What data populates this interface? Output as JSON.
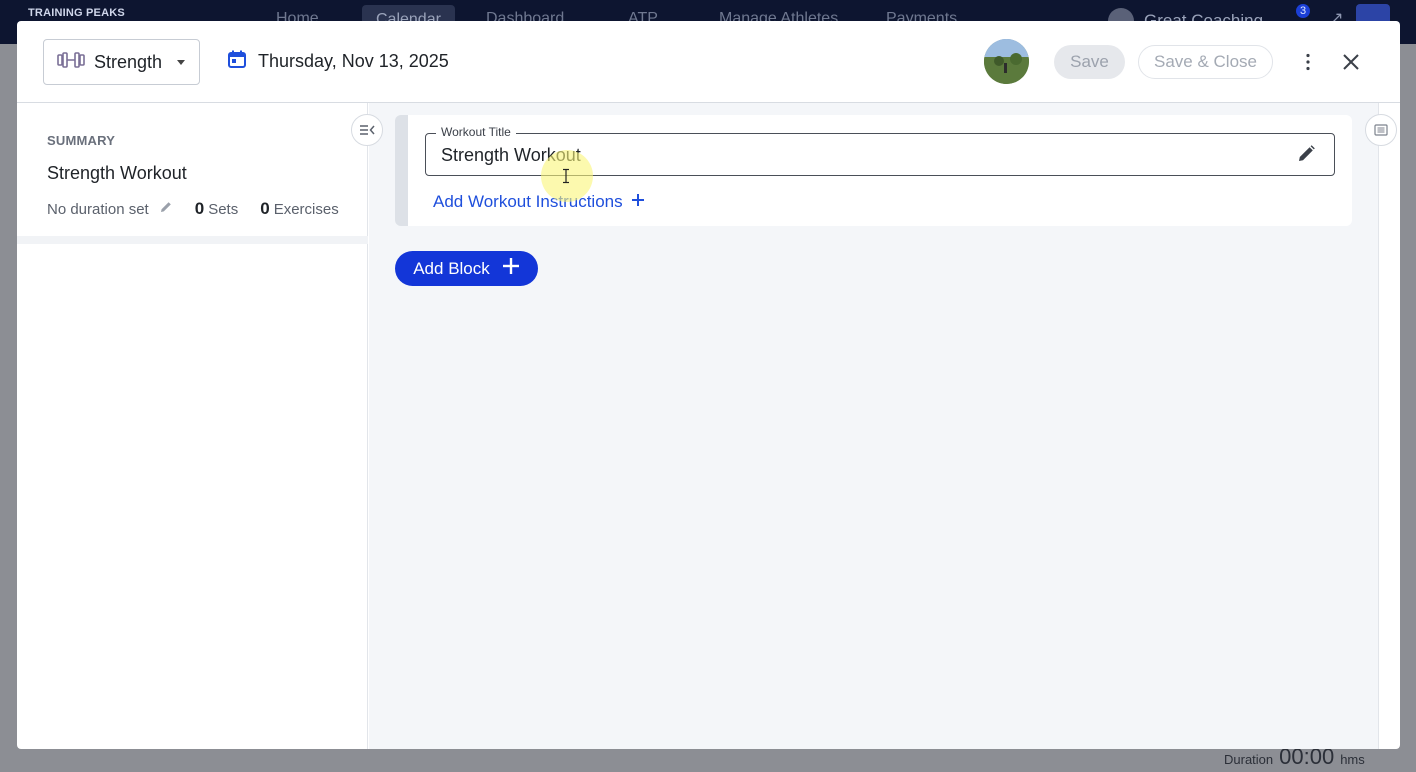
{
  "background_app": {
    "logo": "TRAINING PEAKS",
    "nav": [
      "Home",
      "Calendar",
      "Dashboard",
      "ATP",
      "Manage Athletes",
      "Payments"
    ],
    "active_nav": "Calendar",
    "coach_name": "Great Coaching",
    "notification_count": "3",
    "duration_label": "Duration",
    "duration_value": "00:00",
    "duration_unit": "hms"
  },
  "header": {
    "workout_type": "Strength",
    "workout_type_icon": "dumbbell-icon",
    "date": "Thursday, Nov 13, 2025",
    "date_icon": "calendar-icon",
    "save_label": "Save",
    "save_close_label": "Save & Close"
  },
  "summary": {
    "heading": "SUMMARY",
    "title": "Strength Workout",
    "duration_text": "No duration set",
    "sets_count": "0",
    "sets_label": "Sets",
    "exercises_count": "0",
    "exercises_label": "Exercises"
  },
  "workout": {
    "title_label": "Workout Title",
    "title_value": "Strength Workout",
    "add_instructions_label": "Add Workout Instructions",
    "add_block_label": "Add Block"
  },
  "colors": {
    "primary": "#1336d8",
    "link": "#1f4fdc",
    "nav_bg": "#0d1530"
  }
}
